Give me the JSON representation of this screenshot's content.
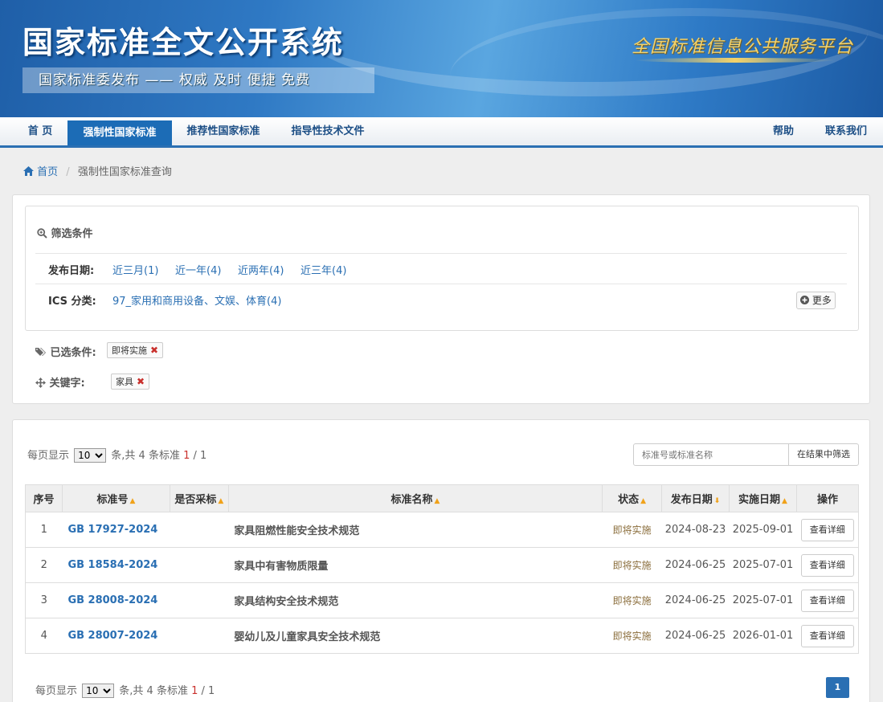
{
  "header": {
    "title": "国家标准全文公开系统",
    "subtitle": "国家标准委发布 —— 权威 及时 便捷 免费",
    "slogan": "全国标准信息公共服务平台"
  },
  "nav": {
    "left": [
      "首 页",
      "强制性国家标准",
      "推荐性国家标准",
      "指导性技术文件"
    ],
    "right": [
      "帮助",
      "联系我们"
    ],
    "active": "强制性国家标准"
  },
  "breadcrumb": {
    "home": "首页",
    "current": "强制性国家标准查询"
  },
  "filters": {
    "title": "筛选条件",
    "date_label": "发布日期:",
    "date_options": [
      "近三月(1)",
      "近一年(4)",
      "近两年(4)",
      "近三年(4)"
    ],
    "ics_label": "ICS 分类:",
    "ics_options": [
      "97_家用和商用设备、文娱、体育(4)"
    ],
    "more": "更多",
    "selected_label": "已选条件:",
    "selected_tag": "即将实施",
    "keyword_label": "关键字:",
    "keyword_tag": "家具"
  },
  "results": {
    "per_page_prefix": "每页显示",
    "per_page": "10",
    "count_text": "条,共 4 条标准",
    "page_current": "1",
    "page_total": "/ 1",
    "search_placeholder": "标准号或标准名称",
    "search_button": "在结果中筛选",
    "columns": [
      "序号",
      "标准号",
      "是否采标",
      "标准名称",
      "状态",
      "发布日期",
      "实施日期",
      "操作"
    ],
    "rows": [
      {
        "no": "1",
        "code": "GB 17927-2024",
        "adopt": "",
        "name": "家具阻燃性能安全技术规范",
        "status": "即将实施",
        "publish": "2024-08-23",
        "implement": "2025-09-01",
        "action": "查看详细"
      },
      {
        "no": "2",
        "code": "GB 18584-2024",
        "adopt": "",
        "name": "家具中有害物质限量",
        "status": "即将实施",
        "publish": "2024-06-25",
        "implement": "2025-07-01",
        "action": "查看详细"
      },
      {
        "no": "3",
        "code": "GB 28008-2024",
        "adopt": "",
        "name": "家具结构安全技术规范",
        "status": "即将实施",
        "publish": "2024-06-25",
        "implement": "2025-07-01",
        "action": "查看详细"
      },
      {
        "no": "4",
        "code": "GB 28007-2024",
        "adopt": "",
        "name": "婴幼儿及儿童家具安全技术规范",
        "status": "即将实施",
        "publish": "2024-06-25",
        "implement": "2026-01-01",
        "action": "查看详细"
      }
    ],
    "pagination": [
      "1"
    ]
  }
}
